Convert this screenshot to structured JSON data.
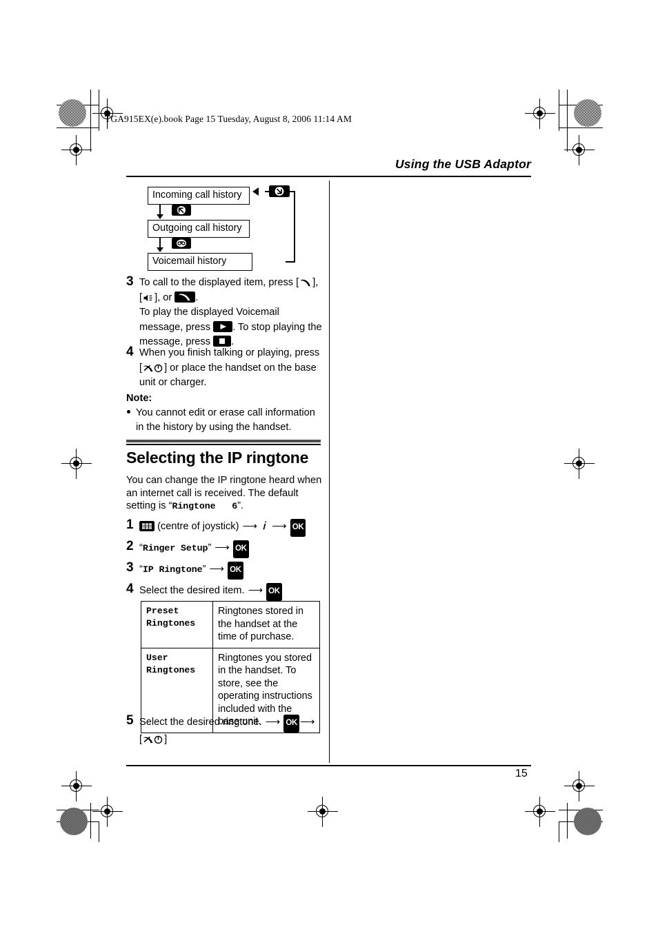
{
  "page": {
    "file_header": "TGA915EX(e).book  Page 15  Tuesday, August 8, 2006  11:14 AM",
    "running_head": "Using the USB Adaptor",
    "page_number": "15"
  },
  "flow_diagram": {
    "boxes": [
      {
        "label": "Incoming call history"
      },
      {
        "label": "Outgoing call history"
      },
      {
        "label": "Voicemail history"
      }
    ],
    "transition_icons": [
      "incoming-call-icon",
      "outgoing-call-icon",
      "voicemail-icon"
    ]
  },
  "steps_history": [
    {
      "number": "3",
      "line1_a": "To call to the displayed item, press ",
      "line1_b": ",",
      "line2_a": ", or ",
      "line2_b": ".",
      "line3": "To play the displayed Voicemail",
      "line4_a": "message, press ",
      "line4_b": ". To stop playing the",
      "line5_a": "message, press ",
      "line5_b": "."
    },
    {
      "number": "4",
      "line1": "When you finish talking or playing, press",
      "line2_b": " or place the handset on the base",
      "line3": "unit or charger."
    }
  ],
  "note": {
    "heading": "Note:",
    "items": [
      "You cannot edit or erase call information in the history by using the handset."
    ]
  },
  "section": {
    "title": "Selecting the IP ringtone",
    "intro_a": "You can change the IP ringtone heard when an internet call is received. The default setting is “",
    "intro_mono": "Ringtone   6",
    "intro_b": "”."
  },
  "steps_ringtone": [
    {
      "number": "1",
      "text_a": "(centre of joystick)",
      "icon_first": "menu-grid-icon",
      "icon_mid": "ringer-info-icon",
      "ok": "OK"
    },
    {
      "number": "2",
      "quoted": "Ringer Setup",
      "ok": "OK"
    },
    {
      "number": "3",
      "quoted": "IP Ringtone",
      "ok": "OK"
    },
    {
      "number": "4",
      "text": "Select the desired item.",
      "ok": "OK"
    },
    {
      "number": "5",
      "text": "Select the desired ringtone.",
      "ok": "OK",
      "end_key": "power-off-key"
    }
  ],
  "ringtone_table": {
    "rows": [
      {
        "key": "Preset\nRingtones",
        "description": "Ringtones stored in the handset at the time of purchase."
      },
      {
        "key": "User\nRingtones",
        "description": "Ringtones you stored in the handset. To store, see the operating instructions included with the base unit."
      }
    ]
  }
}
